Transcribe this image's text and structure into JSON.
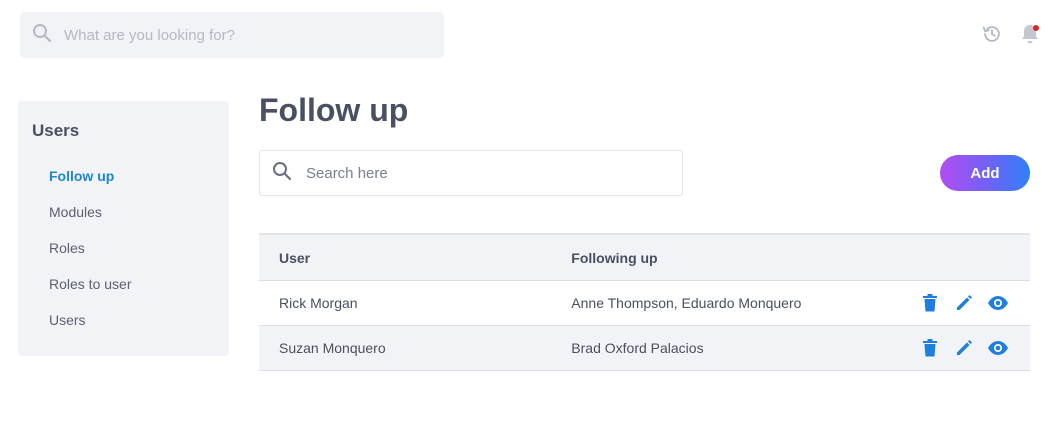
{
  "header": {
    "search_placeholder": "What are you looking for?",
    "icons": [
      "search-icon",
      "history-icon",
      "bell-icon"
    ],
    "notification_dot_color": "#e02424"
  },
  "sidebar": {
    "title": "Users",
    "items": [
      {
        "label": "Follow up",
        "active": true
      },
      {
        "label": "Modules",
        "active": false
      },
      {
        "label": "Roles",
        "active": false
      },
      {
        "label": "Roles to user",
        "active": false
      },
      {
        "label": "Users",
        "active": false
      }
    ]
  },
  "main": {
    "title": "Follow up",
    "search_placeholder": "Search here",
    "add_label": "Add",
    "table": {
      "headers": {
        "user": "User",
        "following": "Following up"
      },
      "rows": [
        {
          "user": "Rick Morgan",
          "following": "Anne Thompson, Eduardo Monquero"
        },
        {
          "user": "Suzan Monquero",
          "following": "Brad Oxford Palacios"
        }
      ],
      "row_action_icons": [
        "trash-icon",
        "edit-icon",
        "eye-icon"
      ]
    }
  },
  "colors": {
    "accent": "#1b87d0",
    "action_icon": "#1f7fe0",
    "add_gradient": [
      "#b24df2",
      "#6d63f5",
      "#2f80f7"
    ],
    "panel_bg": "#f2f3f7"
  }
}
